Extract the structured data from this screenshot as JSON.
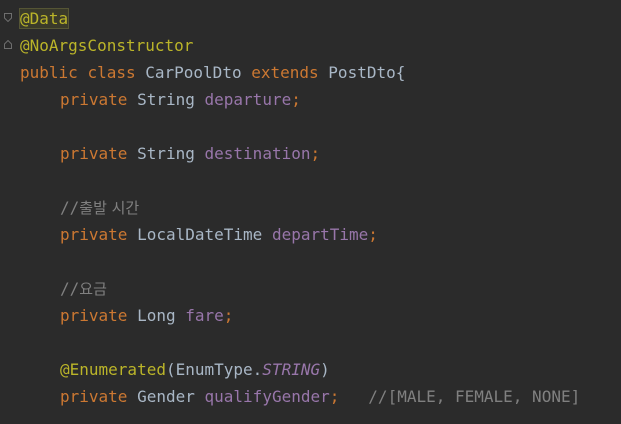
{
  "editor": {
    "lines": {
      "l1_annotation": "@Data",
      "l2_annotation": "@NoArgsConstructor",
      "l3_kw_public": "public",
      "l3_kw_class": "class",
      "l3_classname": "CarPoolDto",
      "l3_kw_extends": "extends",
      "l3_parent": "PostDto{",
      "l4_kw": "private",
      "l4_type": "String",
      "l4_field": "departure",
      "l4_semi": ";",
      "l6_kw": "private",
      "l6_type": "String",
      "l6_field": "destination",
      "l6_semi": ";",
      "l8_comment_prefix": "//",
      "l8_comment_text": "출발 시간",
      "l9_kw": "private",
      "l9_type": "LocalDateTime",
      "l9_field": "departTime",
      "l9_semi": ";",
      "l11_comment_prefix": "//",
      "l11_comment_text": "요금",
      "l12_kw": "private",
      "l12_type": "Long",
      "l12_field": "fare",
      "l12_semi": ";",
      "l14_annotation": "@Enumerated",
      "l14_open": "(EnumType.",
      "l14_static": "STRING",
      "l14_close": ")",
      "l15_kw": "private",
      "l15_type": "Gender",
      "l15_field": "qualifyGender",
      "l15_semi": ";",
      "l15_comment": "//[MALE, FEMALE, NONE]"
    },
    "icons": {
      "fold_1": "fold-marker-icon",
      "fold_2": "fold-marker-icon"
    }
  }
}
